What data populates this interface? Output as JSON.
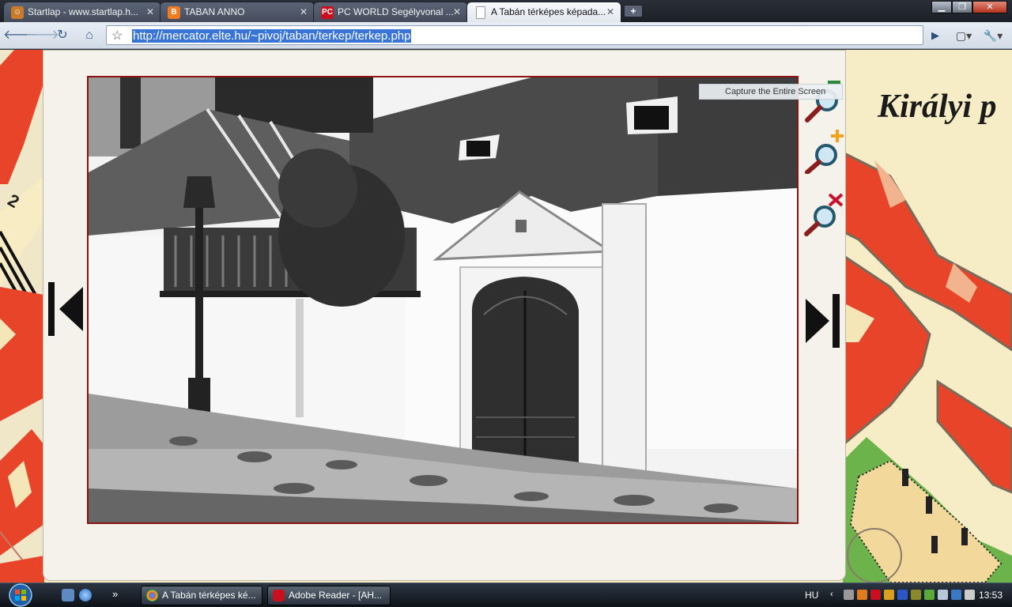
{
  "browser": {
    "tabs": [
      {
        "title": "Startlap - www.startlap.h...",
        "favicon": "startlap-icon",
        "active": false
      },
      {
        "title": "TABAN ANNO",
        "favicon": "blogger-icon",
        "active": false
      },
      {
        "title": "PC WORLD Segélyvonal ...",
        "favicon": "pcworld-icon",
        "active": false
      },
      {
        "title": "A Tabán térképes képada...",
        "favicon": "page-icon",
        "active": true
      }
    ],
    "new_tab_label": "+",
    "url": "http://mercator.elte.hu/~pivoj/taban/terkep/terkep.php",
    "toolbar_icons": [
      "back-icon",
      "forward-icon",
      "reload-icon",
      "home-icon",
      "star-icon",
      "go-icon",
      "page-menu-icon",
      "wrench-icon"
    ]
  },
  "page": {
    "map_label": "Királyi p",
    "map_street_number": "2",
    "tooltip": "Capture the Entire Screen",
    "controls": [
      "prev-arrow-icon",
      "next-arrow-icon",
      "zoom-out-icon",
      "zoom-in-icon",
      "zoom-close-icon"
    ],
    "colors": {
      "frame": "#8a1414",
      "map_red": "#e8442a",
      "map_cream": "#f4e6b7",
      "panel": "#f4f2ea"
    }
  },
  "taskbar": {
    "tasks": [
      {
        "label": "A Tabán térképes ké...",
        "icon": "chrome-icon"
      },
      {
        "label": "Adobe Reader - [AH...",
        "icon": "adobe-reader-icon"
      }
    ],
    "language": "HU",
    "clock": "13:53",
    "overflow": "»"
  }
}
